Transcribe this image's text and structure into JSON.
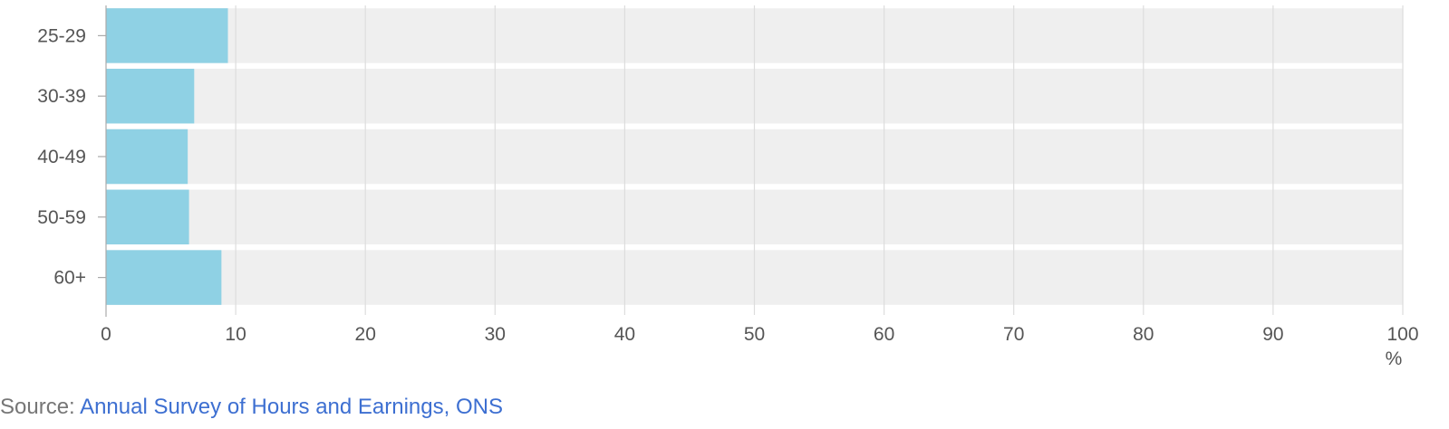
{
  "chart_data": {
    "type": "bar",
    "orientation": "horizontal",
    "categories": [
      "25-29",
      "30-39",
      "40-49",
      "50-59",
      "60+"
    ],
    "values": [
      9.4,
      6.8,
      6.3,
      6.4,
      8.9
    ],
    "xlim": [
      0,
      100
    ],
    "x_ticks": [
      0,
      10,
      20,
      30,
      40,
      50,
      60,
      70,
      80,
      90,
      100
    ],
    "x_unit": "%",
    "grid": true,
    "colors": {
      "bar": "#8fd1e4",
      "track": "#efefef",
      "grid": "#dddddd",
      "axis": "#aaaaaa"
    }
  },
  "source": {
    "prefix": "Source: ",
    "link_text": "Annual Survey of Hours and Earnings, ONS"
  }
}
